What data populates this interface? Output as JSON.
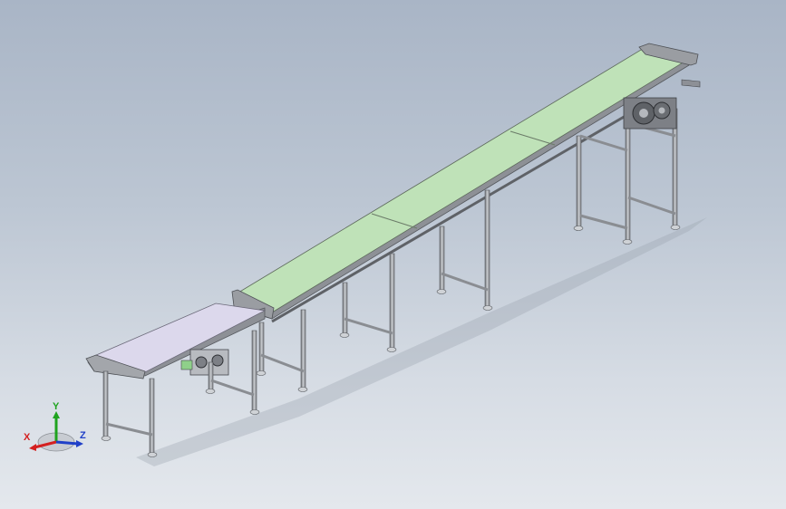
{
  "window": {
    "background_top": "#a9b5c6",
    "background_bottom": "#e4e8ed"
  },
  "model": {
    "incline_belt_color": "#bfe2b8",
    "feed_belt_color": "#dcd8ec",
    "frame_color": "#8a8d92"
  },
  "triad": {
    "x_label": "X",
    "y_label": "Y",
    "z_label": "Z",
    "x_color": "#d42020",
    "y_color": "#1fa31f",
    "z_color": "#2040c8"
  }
}
